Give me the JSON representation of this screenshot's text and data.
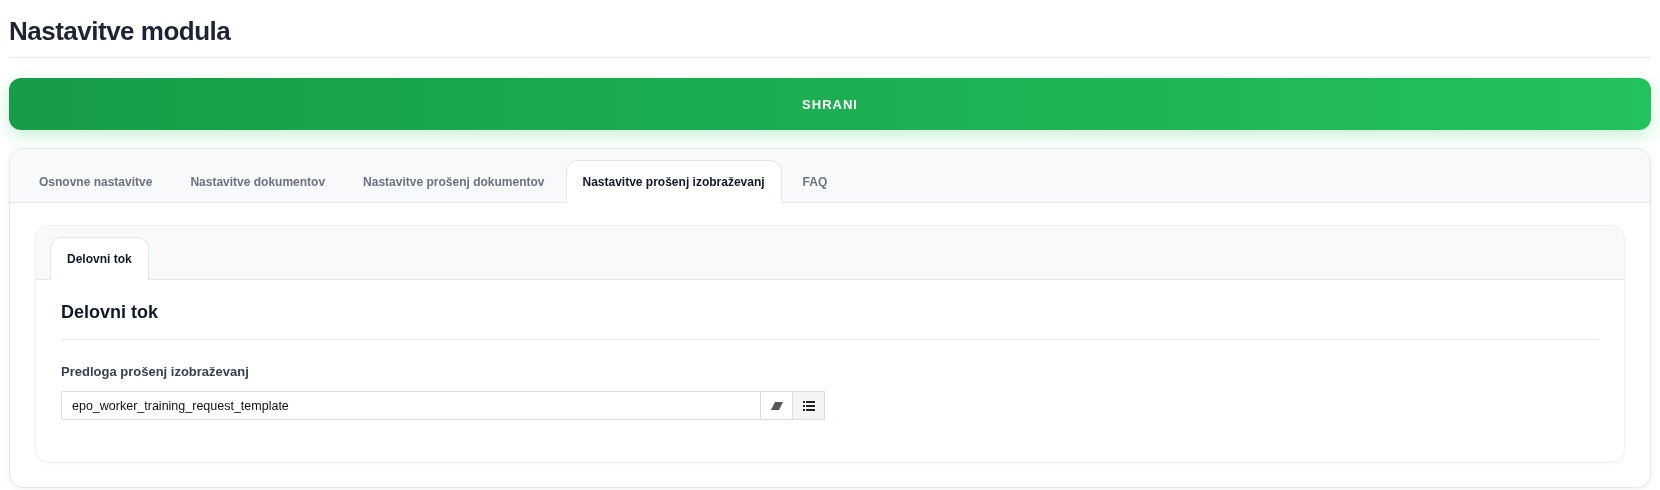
{
  "page_title": "Nastavitve modula",
  "save_button": "SHRANI",
  "tabs": [
    {
      "label": "Osnovne nastavitve",
      "selected": false
    },
    {
      "label": "Nastavitve dokumentov",
      "selected": false
    },
    {
      "label": "Nastavitve prošenj dokumentov",
      "selected": false
    },
    {
      "label": "Nastavitve prošenj izobraževanj",
      "selected": true
    },
    {
      "label": "FAQ",
      "selected": false
    }
  ],
  "subtabs": [
    {
      "label": "Delovni tok",
      "selected": true
    }
  ],
  "section": {
    "title": "Delovni tok",
    "fields": [
      {
        "label": "Predloga prošenj izobraževanj",
        "value": "epo_worker_training_request_template"
      }
    ]
  }
}
